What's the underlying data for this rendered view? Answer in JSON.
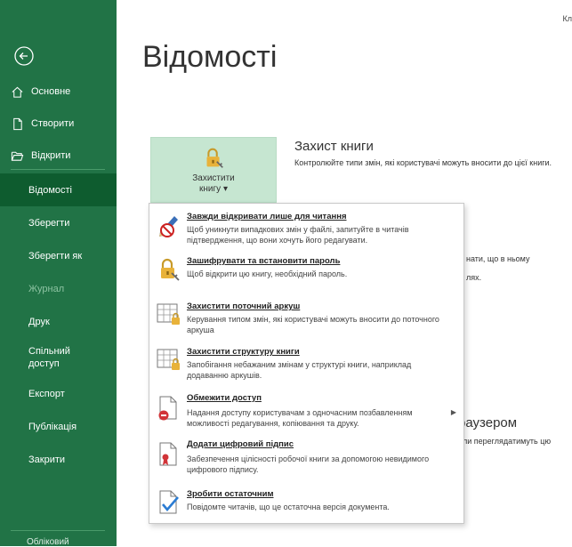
{
  "top_right": "Кл",
  "sidebar": {
    "top_items": [
      {
        "label": "Основне"
      },
      {
        "label": "Створити"
      },
      {
        "label": "Відкрити"
      }
    ],
    "items": [
      {
        "label": "Відомості"
      },
      {
        "label": "Зберегти"
      },
      {
        "label": "Зберегти як"
      },
      {
        "label": "Журнал"
      },
      {
        "label": "Друк"
      },
      {
        "label": "Спільний доступ"
      },
      {
        "label": "Експорт"
      },
      {
        "label": "Публікація"
      },
      {
        "label": "Закрити"
      }
    ],
    "bottom_stub": "Обліковий"
  },
  "main": {
    "title": "Відомості",
    "protect_button": {
      "line1": "Захистити",
      "line2": "книгу ▾"
    },
    "section_title": "Захист книги",
    "section_desc": "Контролюйте типи змін, які користувачі можуть вносити до цієї книги.",
    "bg_text1": "нати, що в ньому",
    "bg_text2": "лях.",
    "bg_title3": "раузером",
    "bg_text3": "али переглядатимуть цю"
  },
  "dropdown": {
    "items": [
      {
        "title": "Завжди відкривати лише для читання",
        "desc": "Щоб уникнути випадкових змін у файлі, запитуйте в читачів підтвердження, що вони хочуть його редагувати."
      },
      {
        "title": "Зашифрувати та встановити пароль",
        "desc": "Щоб відкрити цю книгу, необхідний пароль."
      },
      {
        "title": "Захистити поточний аркуш",
        "desc": "Керування типом змін, які користувачі можуть вносити до поточного аркуша"
      },
      {
        "title": "Захистити структуру книги",
        "desc": "Запобігання небажаним змінам у структурі книги, наприклад додаванню аркушів."
      },
      {
        "title": "Обмежити доступ",
        "desc": "Надання доступу користувачам з одночасним позбавленням можливості редагування, копіювання та друку."
      },
      {
        "title": "Додати цифровий підпис",
        "desc": "Забезпечення цілісності робочої книги за допомогою невидимого цифрового підпису."
      },
      {
        "title": "Зробити остаточним",
        "desc": "Повідомте читачів, що це остаточна версія документа."
      }
    ]
  },
  "colors": {
    "sidebar": "#217346",
    "active": "#0e5c2f",
    "button": "#c6e6d1"
  }
}
